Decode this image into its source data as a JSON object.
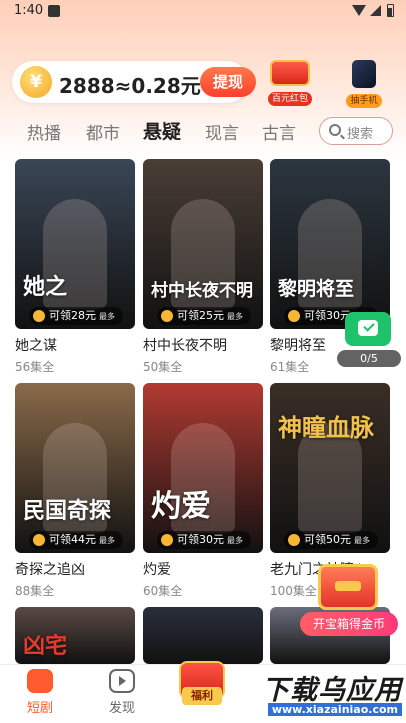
{
  "status_bar": {
    "time": "1:40"
  },
  "header": {
    "coin_symbol": "¥",
    "coin_text": "2888≈0.28元",
    "withdraw_label": "提现",
    "promo_redpacket_label": "百元红包",
    "promo_phone_label": "抽手机"
  },
  "categories": {
    "tabs": [
      "热播",
      "都市",
      "悬疑",
      "现言",
      "古言"
    ],
    "active": "悬疑",
    "search_placeholder": "搜索"
  },
  "dramas": [
    {
      "title": "她之谋",
      "poster_text": "她之",
      "episodes": "56集全",
      "reward": "可领28元",
      "reward_suffix": "最多",
      "poster_color": "#3a4656"
    },
    {
      "title": "村中长夜不明",
      "poster_text": "村中长夜不明",
      "episodes": "50集全",
      "reward": "可领25元",
      "reward_suffix": "最多",
      "poster_color": "#4a3e36"
    },
    {
      "title": "黎明将至",
      "poster_text": "黎明将至",
      "episodes": "61集全",
      "reward": "可领30元",
      "reward_suffix": "最多",
      "poster_color": "#2c3640"
    },
    {
      "title": "奇探之追凶",
      "poster_text": "民国奇探",
      "episodes": "88集全",
      "reward": "可领44元",
      "reward_suffix": "最多",
      "poster_color": "#8a6a4a"
    },
    {
      "title": "灼爱",
      "poster_text": "灼爱",
      "episodes": "60集全",
      "reward": "可领30元",
      "reward_suffix": "最多",
      "poster_color": "#b23a32"
    },
    {
      "title": "老九门之神瞳血脉",
      "poster_text": "神瞳血脉",
      "episodes": "100集全",
      "reward": "可领50元",
      "reward_suffix": "最多",
      "poster_color": "#3a2e26"
    },
    {
      "title": "",
      "poster_text": "凶宅",
      "episodes": "",
      "reward": "",
      "reward_suffix": "",
      "poster_color": "#5a4a44"
    },
    {
      "title": "",
      "poster_text": "",
      "episodes": "",
      "reward": "",
      "reward_suffix": "",
      "poster_color": "#2a2f3c"
    },
    {
      "title": "",
      "poster_text": "",
      "episodes": "",
      "reward": "",
      "reward_suffix": "",
      "poster_color": "#6a6e7a"
    }
  ],
  "task_widget": {
    "progress": "0/5"
  },
  "treasure_chest": {
    "label": "开宝箱得金币"
  },
  "bottom_nav": {
    "shorts_label": "短剧",
    "discover_label": "发现",
    "welfare_label": "福利"
  },
  "watermark": {
    "main": "下载乌应用",
    "url": "www.xiazainiao.com"
  },
  "colors": {
    "accent": "#ff5b2e",
    "withdraw": "#ff3f2e",
    "task_green": "#1ec26a"
  }
}
